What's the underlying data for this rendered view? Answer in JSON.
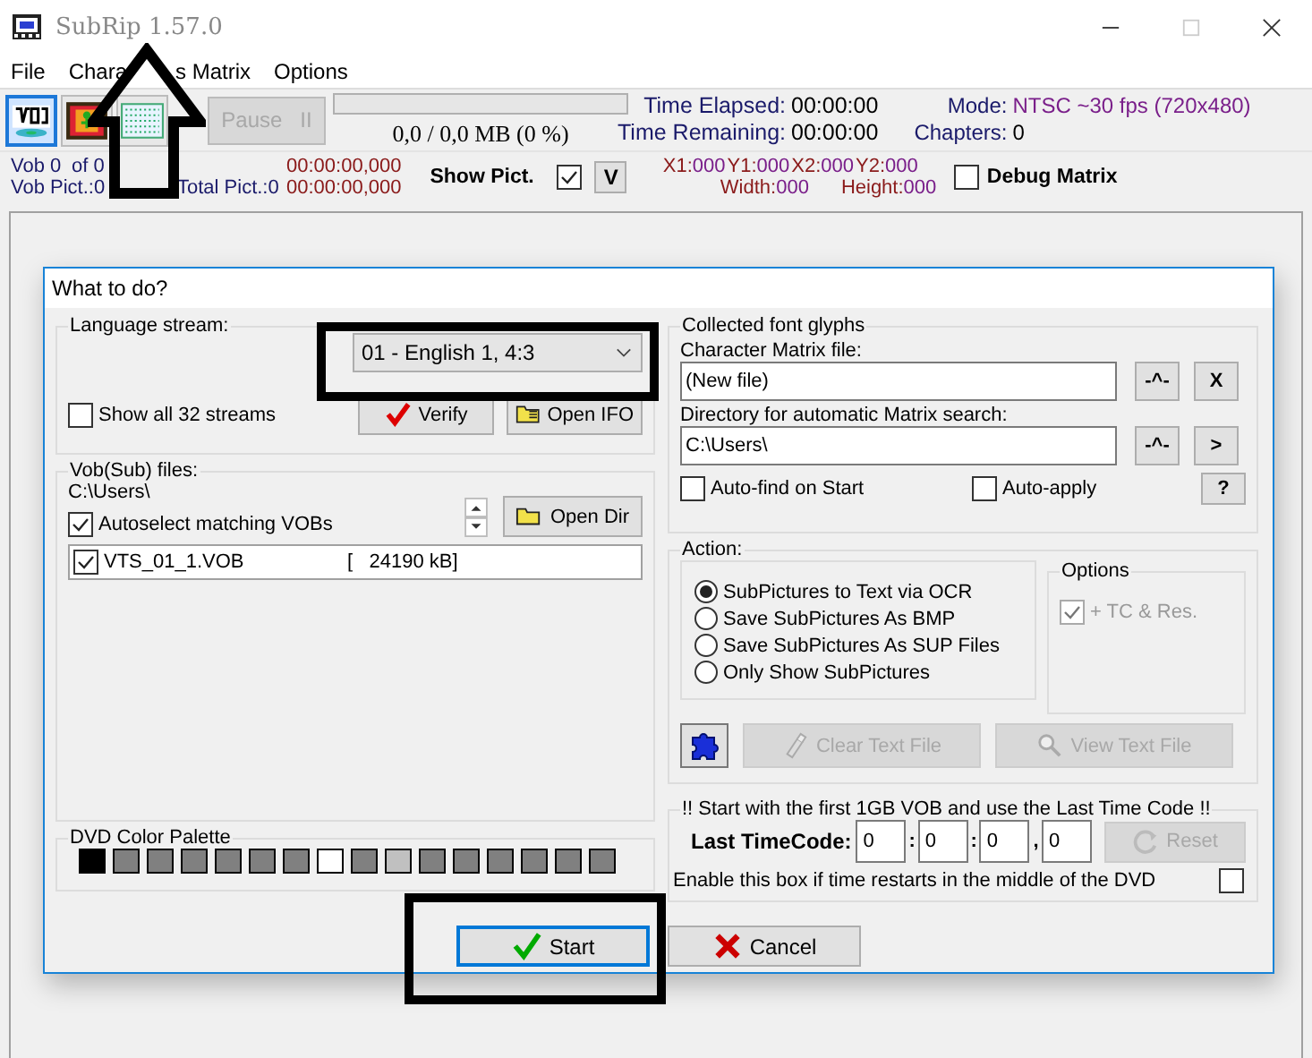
{
  "window": {
    "title": "SubRip 1.57.0"
  },
  "menu": [
    {
      "label": "File"
    },
    {
      "label": "Chara",
      "label_after_arrow": "s Matrix"
    },
    {
      "label": "Options"
    }
  ],
  "toolbar": {
    "tools": [
      {
        "kind": "vob",
        "selected": true
      },
      {
        "kind": "film",
        "selected": false
      },
      {
        "kind": "matrix",
        "selected": false
      }
    ],
    "pause": {
      "label": "Pause",
      "symbol": "II",
      "disabled": true
    },
    "progress": {
      "level": 0,
      "reading": "0,0 / 0,0 MB (0 %)"
    },
    "time_elapsed": {
      "label": "Time Elapsed:",
      "value": "00:00:00"
    },
    "time_remaining": {
      "label": "Time Remaining:",
      "value": "00:00:00"
    },
    "mode": {
      "label": "Mode:",
      "value": "NTSC ~30 fps (720x480)"
    },
    "chapters": {
      "label": "Chapters:",
      "value": "0"
    }
  },
  "info_bar": {
    "vob": "Vob 0",
    "of": "of 0",
    "vob_pict": "Vob Pict.:0",
    "total_pict": "Total Pict.:0",
    "times": [
      "00:00:00,000",
      "00:00:00,000"
    ],
    "show_pict": {
      "label": "Show Pict.",
      "checked": true
    },
    "v_button": "V",
    "coords": [
      {
        "label": "X1:",
        "value": "000"
      },
      {
        "label": "Y1:",
        "value": "000"
      },
      {
        "label": "X2:",
        "value": "000"
      },
      {
        "label": "Y2:",
        "value": "000"
      }
    ],
    "size": [
      {
        "label": "Width:",
        "value": "000"
      },
      {
        "label": "Height:",
        "value": "000"
      }
    ],
    "debug_matrix": {
      "label": "Debug Matrix",
      "checked": false
    }
  },
  "dialog": {
    "title": "What to do?",
    "language_stream": {
      "title": "Language stream:",
      "selected_stream": "01 - English 1, 4:3",
      "show_all": {
        "label": "Show all 32 streams",
        "checked": false
      },
      "buttons": [
        {
          "label": "Verify",
          "kind": "verify"
        },
        {
          "label": "Open IFO",
          "kind": "folder"
        }
      ]
    },
    "vob_files": {
      "title": "Vob(Sub) files:",
      "path": "C:\\Users\\",
      "autoselect": {
        "label": "Autoselect matching VOBs",
        "checked": true
      },
      "open_dir": "Open Dir",
      "files": [
        {
          "name": "VTS_01_1.VOB",
          "size": "[   24190 kB]",
          "checked": true
        }
      ]
    },
    "palette": {
      "title": "DVD Color Palette",
      "colors": [
        {
          "color": "#000000"
        },
        {
          "color": "#808080"
        },
        {
          "color": "#808080"
        },
        {
          "color": "#808080"
        },
        {
          "color": "#808080"
        },
        {
          "color": "#808080"
        },
        {
          "color": "#808080"
        },
        {
          "color": "#ffffff"
        },
        {
          "color": "#808080"
        },
        {
          "color": "#c0c0c0"
        },
        {
          "color": "#808080"
        },
        {
          "color": "#808080"
        },
        {
          "color": "#808080"
        },
        {
          "color": "#808080"
        },
        {
          "color": "#808080"
        },
        {
          "color": "#808080"
        }
      ]
    },
    "font_glyphs": {
      "title": "Collected font glyphs",
      "matrix_file": {
        "label": "Character Matrix file:",
        "value": "(New file)",
        "buttons": [
          "-^-",
          "X"
        ]
      },
      "directory": {
        "label": "Directory for automatic Matrix search:",
        "value": "C:\\Users\\",
        "buttons": [
          "-^-",
          ">"
        ]
      },
      "auto_find": {
        "label": "Auto-find on Start",
        "checked": false
      },
      "auto_apply": {
        "label": "Auto-apply",
        "checked": false
      },
      "help": "?"
    },
    "action": {
      "title": "Action:",
      "options": [
        {
          "label": "SubPictures to Text via OCR",
          "selected": true
        },
        {
          "label": "Save SubPictures As BMP",
          "selected": false
        },
        {
          "label": "Save SubPictures As SUP Files",
          "selected": false
        },
        {
          "label": "Only Show SubPictures",
          "selected": false
        }
      ],
      "options_group": {
        "title": "Options",
        "tc_res": {
          "label": "+ TC & Res.",
          "checked": true,
          "disabled": true
        }
      },
      "buttons": [
        {
          "kind": "puzzle",
          "disabled": false
        },
        {
          "kind": "clear",
          "label": "Clear Text File",
          "disabled": true
        },
        {
          "kind": "view",
          "label": "View Text File",
          "disabled": true
        }
      ]
    },
    "timecode": {
      "title": "!! Start with the first 1GB VOB and use the Last Time Code !!",
      "label": "Last TimeCode:",
      "fields": [
        {
          "value": "0"
        },
        {
          "separator": ":",
          "value": "0"
        },
        {
          "separator": ":",
          "value": "0"
        },
        {
          "separator": ",",
          "value": "0"
        }
      ],
      "reset": {
        "label": "Reset",
        "disabled": true
      },
      "restart": {
        "label": "Enable this box if time restarts in the middle of the DVD",
        "checked": false
      }
    },
    "buttons": [
      {
        "kind": "start",
        "label": "Start",
        "default": true
      },
      {
        "kind": "cancel",
        "label": "Cancel",
        "default": false
      }
    ]
  }
}
